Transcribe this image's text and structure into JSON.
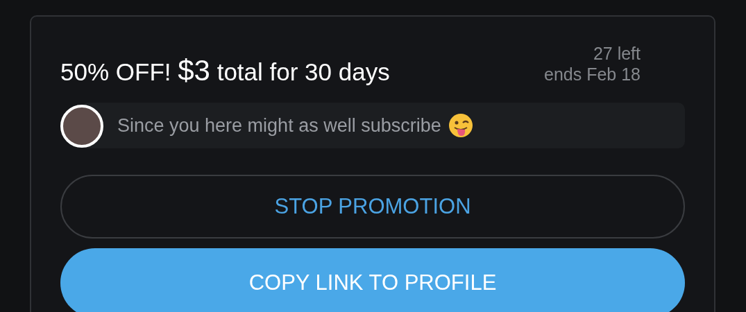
{
  "promotion": {
    "title": {
      "discount": "50% OFF!",
      "price": "$3",
      "term": "total for 30 days"
    },
    "remaining": "27 left",
    "ends": "ends Feb 18"
  },
  "message": {
    "text": "Since you here might as well subscribe"
  },
  "buttons": [
    {
      "label": "STOP PROMOTION",
      "kind": "outline"
    },
    {
      "label": "COPY LINK TO PROFILE",
      "kind": "filled"
    }
  ]
}
